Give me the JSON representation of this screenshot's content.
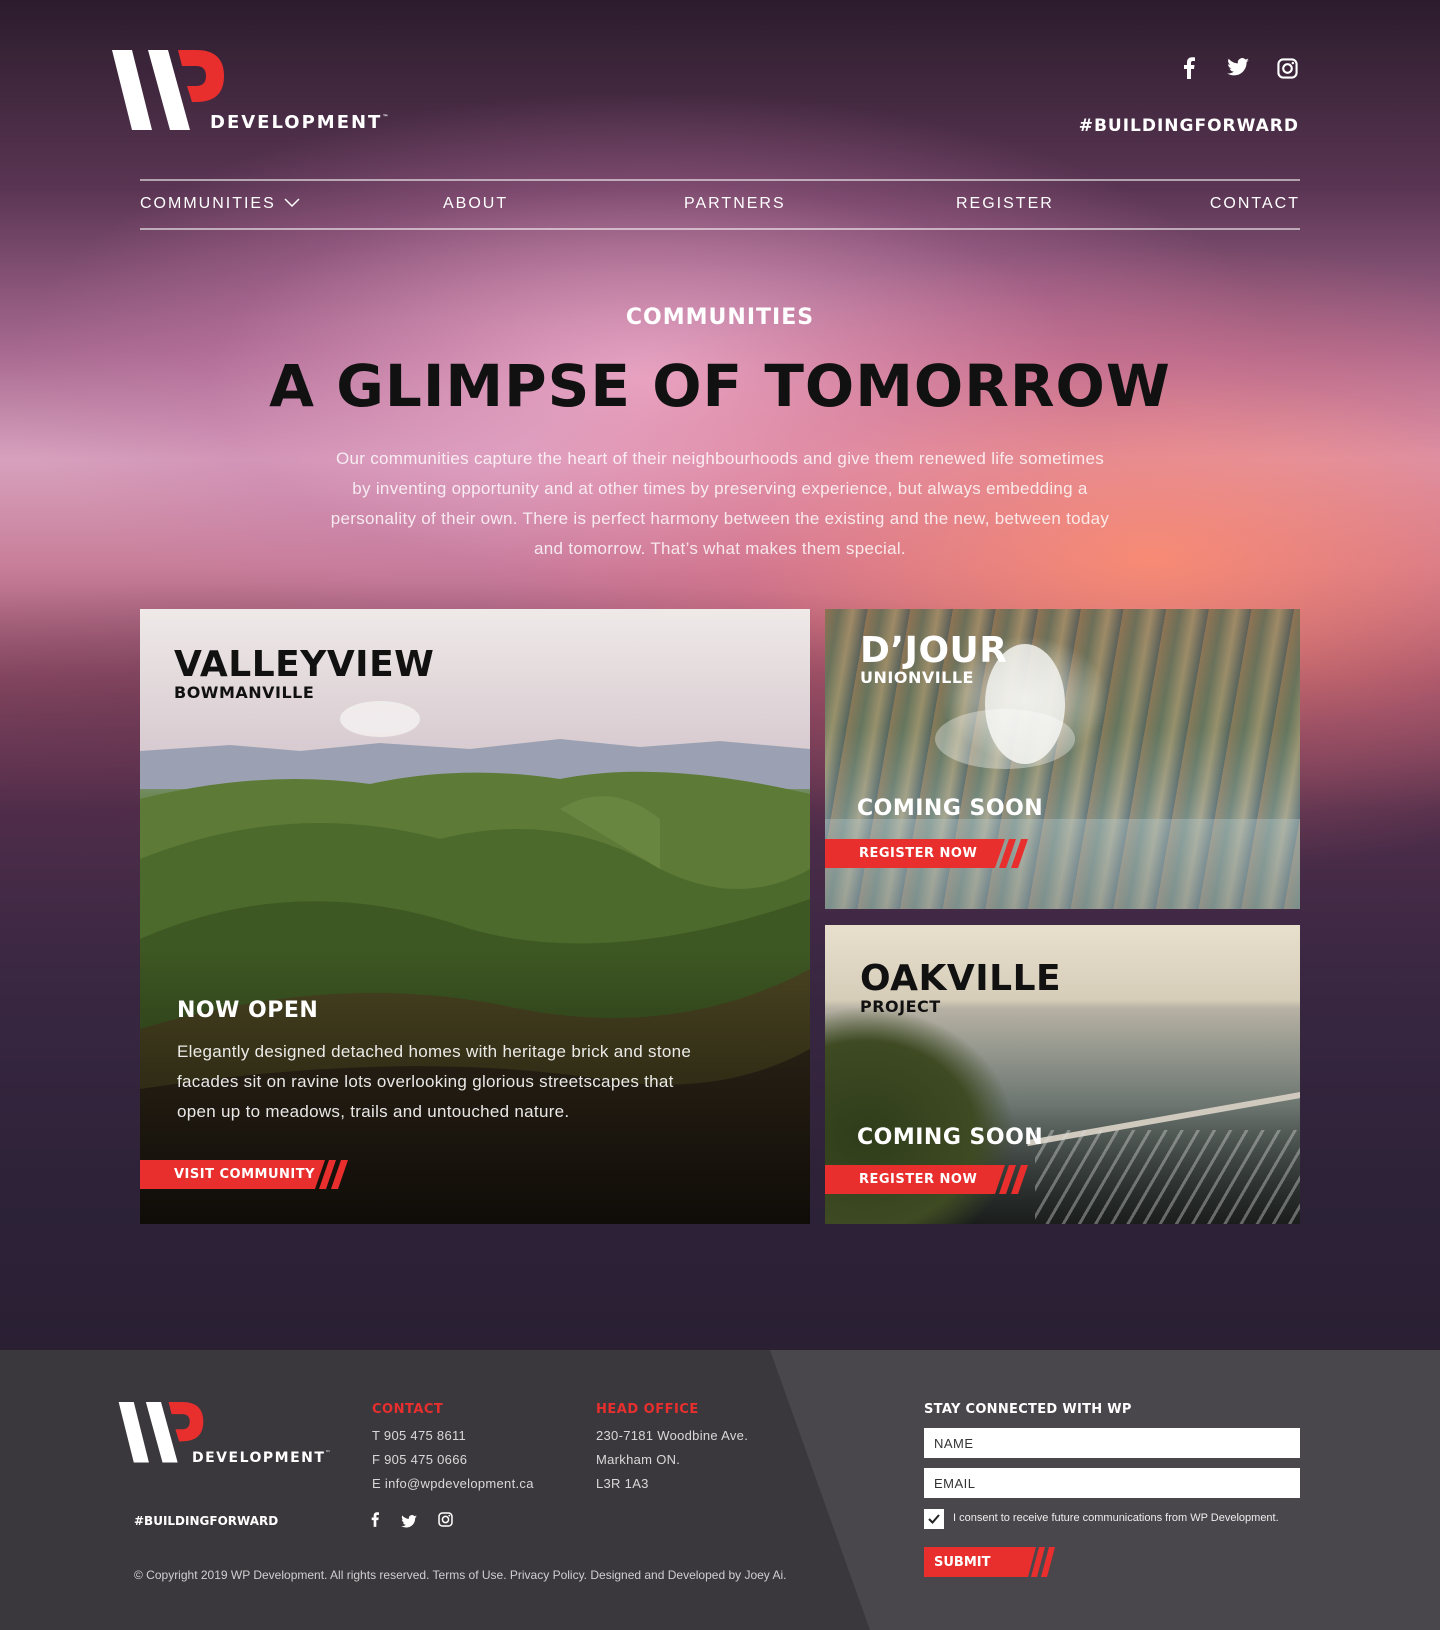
{
  "brand": {
    "logo_text": "DEVELOPMENT",
    "trademark": "™",
    "hashtag": "#BUILDINGFORWARD",
    "accent_color": "#e92e2e"
  },
  "social": [
    "facebook-icon",
    "twitter-icon",
    "instagram-icon"
  ],
  "nav": {
    "items": [
      {
        "label": "COMMUNITIES"
      },
      {
        "label": "ABOUT"
      },
      {
        "label": "PARTNERS"
      },
      {
        "label": "REGISTER"
      },
      {
        "label": "CONTACT"
      }
    ]
  },
  "hero": {
    "eyebrow": "COMMUNITIES",
    "headline": "A GLIMPSE OF TOMORROW",
    "intro": "Our communities capture the heart of their neighbourhoods and give them renewed life sometimes by inventing opportunity and at other times by preserving experience, but always embedding a personality of their own. There is perfect harmony between the existing and the new, between today and tomorrow. That’s what makes them special."
  },
  "communities": [
    {
      "name": "VALLEYVIEW",
      "location": "BOWMANVILLE",
      "status": "NOW OPEN",
      "description": "Elegantly designed detached homes with heritage brick and stone facades sit on ravine lots overlooking glorious streetscapes that open up to meadows, trails and untouched nature.",
      "cta": "VISIT COMMUNITY"
    },
    {
      "name": "D’JOUR",
      "location": "UNIONVILLE",
      "status": "COMING SOON",
      "cta": "REGISTER NOW"
    },
    {
      "name": "OAKVILLE",
      "location": "PROJECT",
      "status": "COMING SOON",
      "cta": "REGISTER NOW"
    }
  ],
  "footer": {
    "logo_text": "DEVELOPMENT",
    "trademark": "™",
    "hashtag": "#BUILDINGFORWARD",
    "contact": {
      "heading": "CONTACT",
      "phone": "T 905 475 8611",
      "fax": "F 905 475 0666",
      "email": "E info@wpdevelopment.ca"
    },
    "office": {
      "heading": "HEAD OFFICE",
      "line1": "230-7181 Woodbine Ave.",
      "line2": "Markham  ON.",
      "line3": "L3R 1A3"
    },
    "copyright": "© Copyright 2019 WP Development. All rights reserved. Terms of Use. Privacy Policy. Designed and Developed by Joey Ai.",
    "form": {
      "title": "STAY CONNECTED WITH WP",
      "name_placeholder": "NAME",
      "email_placeholder": "EMAIL",
      "consent": "I consent to receive future communications from WP Development.",
      "consent_checked": true,
      "submit": "SUBMIT"
    }
  }
}
